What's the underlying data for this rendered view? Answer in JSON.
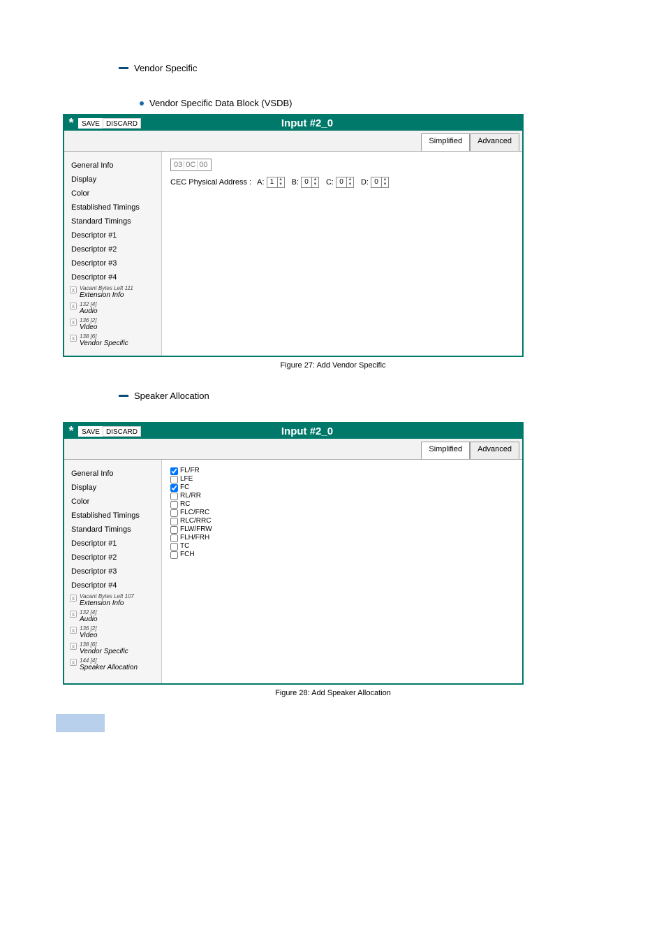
{
  "headings": {
    "vendor": "Vendor Specific",
    "vendorBullet": "Vendor Specific Data Block (VSDB)",
    "speaker": "Speaker Allocation"
  },
  "figures": {
    "fig26": "Figure 27: Add Vendor Specific",
    "fig27": "Figure 28: Add Speaker Allocation"
  },
  "window": {
    "title": "Input #2_0",
    "save": "SAVE",
    "discard": "DISCARD",
    "tabSimplified": "Simplified",
    "tabAdvanced": "Advanced"
  },
  "sidebar": {
    "items": [
      "General Info",
      "Display",
      "Color",
      "Established Timings",
      "Standard Timings",
      "Descriptor #1",
      "Descriptor #2",
      "Descriptor #3",
      "Descriptor #4"
    ],
    "ext1": [
      {
        "top": "Vacant Bytes Left 111",
        "label": "Extension Info"
      },
      {
        "top": "132 [4]",
        "label": "Audio"
      },
      {
        "top": "136 [2]",
        "label": "Video"
      },
      {
        "top": "138 [6]",
        "label": "Vendor Specific"
      }
    ],
    "ext2": [
      {
        "top": "Vacant Bytes Left 107",
        "label": "Extension Info"
      },
      {
        "top": "132 [4]",
        "label": "Audio"
      },
      {
        "top": "136 [2]",
        "label": "Video"
      },
      {
        "top": "138 [6]",
        "label": "Vendor Specific"
      },
      {
        "top": "144 [4]",
        "label": "Speaker Allocation"
      }
    ]
  },
  "cec": {
    "hex": [
      "03",
      "0C",
      "00"
    ],
    "label": "CEC Physical Address :",
    "fields": [
      {
        "name": "A:",
        "val": "1"
      },
      {
        "name": "B:",
        "val": "0"
      },
      {
        "name": "C:",
        "val": "0"
      },
      {
        "name": "D:",
        "val": "0"
      }
    ]
  },
  "speakers": [
    {
      "label": "FL/FR",
      "checked": true
    },
    {
      "label": "LFE",
      "checked": false
    },
    {
      "label": "FC",
      "checked": true
    },
    {
      "label": "RL/RR",
      "checked": false
    },
    {
      "label": "RC",
      "checked": false
    },
    {
      "label": "FLC/FRC",
      "checked": false
    },
    {
      "label": "RLC/RRC",
      "checked": false
    },
    {
      "label": "FLW/FRW",
      "checked": false
    },
    {
      "label": "FLH/FRH",
      "checked": false
    },
    {
      "label": "TC",
      "checked": false
    },
    {
      "label": "FCH",
      "checked": false
    }
  ]
}
